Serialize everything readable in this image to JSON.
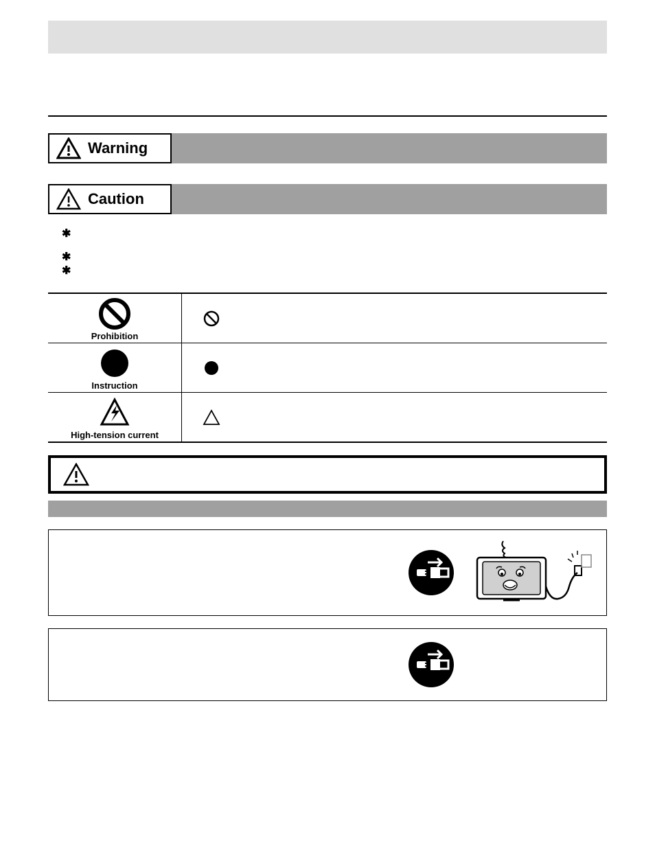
{
  "labels": {
    "warning": "Warning",
    "caution": "Caution"
  },
  "table_captions": {
    "prohibition": "Prohibition",
    "instruction": "Instruction",
    "high_tension": "High-tension current"
  },
  "icons": {
    "warning_triangle": "warning",
    "prohibition_circle": "prohibition",
    "instruction_circle": "instruction",
    "high_tension_triangle": "high-tension",
    "small_prohibition": "prohibition-small",
    "small_circle": "circle-small",
    "small_triangle": "triangle-small",
    "plug": "unplug",
    "tv_smoke": "tv-smoking-cartoon"
  },
  "bullets": {
    "count": 3
  }
}
